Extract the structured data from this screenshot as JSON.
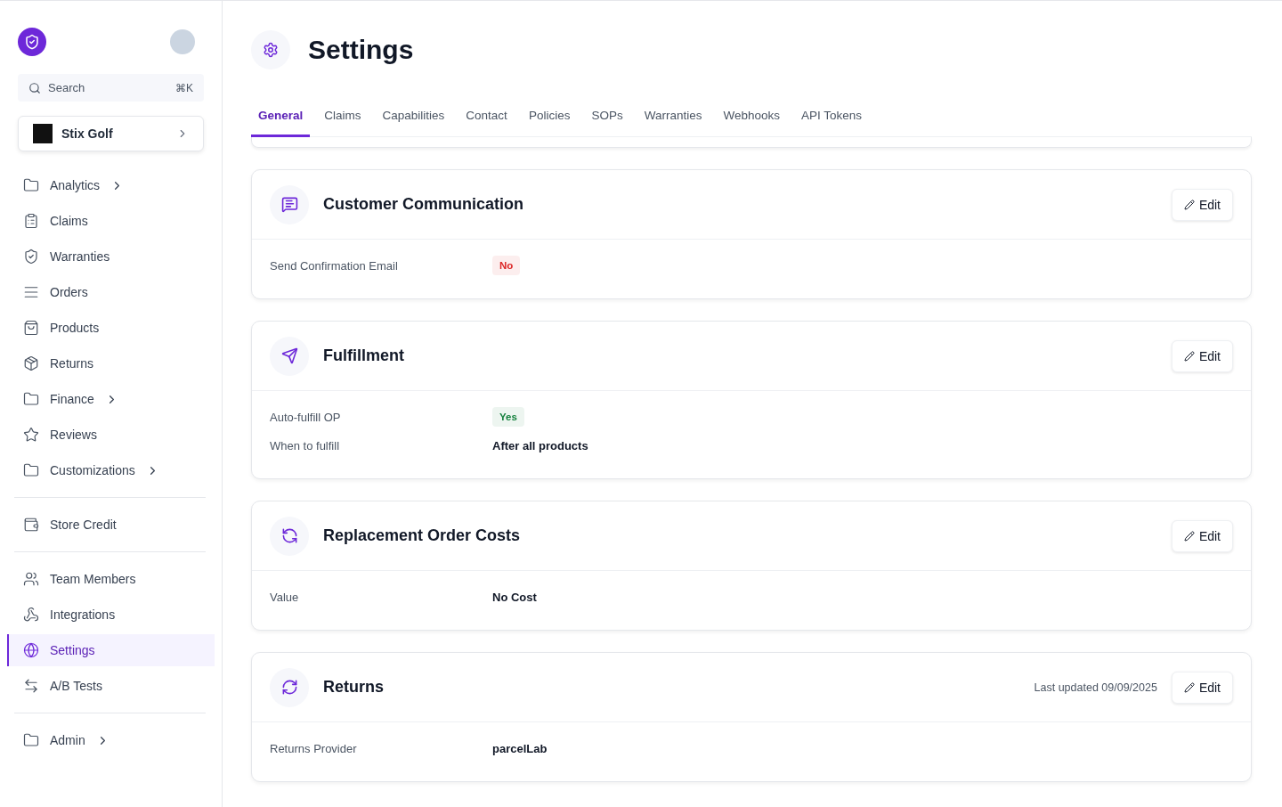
{
  "sidebar": {
    "search": {
      "placeholder": "Search",
      "shortcut": "⌘K"
    },
    "store": {
      "name": "Stix Golf"
    },
    "groups": [
      {
        "items": [
          {
            "label": "Analytics",
            "expandable": true,
            "selected": false
          },
          {
            "label": "Claims",
            "expandable": false,
            "selected": false
          },
          {
            "label": "Warranties",
            "expandable": false,
            "selected": false
          },
          {
            "label": "Orders",
            "expandable": false,
            "selected": false
          },
          {
            "label": "Products",
            "expandable": false,
            "selected": false
          },
          {
            "label": "Returns",
            "expandable": false,
            "selected": false
          },
          {
            "label": "Finance",
            "expandable": true,
            "selected": false
          },
          {
            "label": "Reviews",
            "expandable": false,
            "selected": false
          },
          {
            "label": "Customizations",
            "expandable": true,
            "selected": false
          }
        ]
      },
      {
        "items": [
          {
            "label": "Store Credit",
            "expandable": false,
            "selected": false
          }
        ]
      },
      {
        "items": [
          {
            "label": "Team Members",
            "expandable": false,
            "selected": false
          },
          {
            "label": "Integrations",
            "expandable": false,
            "selected": false
          },
          {
            "label": "Settings",
            "expandable": false,
            "selected": true
          },
          {
            "label": "A/B Tests",
            "expandable": false,
            "selected": false
          }
        ]
      },
      {
        "items": [
          {
            "label": "Admin",
            "expandable": true,
            "selected": false
          }
        ]
      }
    ]
  },
  "page": {
    "title": "Settings"
  },
  "tabs": [
    {
      "label": "General",
      "selected": true
    },
    {
      "label": "Claims",
      "selected": false
    },
    {
      "label": "Capabilities",
      "selected": false
    },
    {
      "label": "Contact",
      "selected": false
    },
    {
      "label": "Policies",
      "selected": false
    },
    {
      "label": "SOPs",
      "selected": false
    },
    {
      "label": "Warranties",
      "selected": false
    },
    {
      "label": "Webhooks",
      "selected": false
    },
    {
      "label": "API Tokens",
      "selected": false
    }
  ],
  "cards": [
    {
      "kind": "chat",
      "title": "Customer Communication",
      "edit": "Edit",
      "fields": [
        {
          "label": "Send Confirmation Email",
          "kind": "badge",
          "value": "No",
          "color": "#dc2626"
        }
      ]
    },
    {
      "kind": "send",
      "title": "Fulfillment",
      "edit": "Edit",
      "fields": [
        {
          "label": "Auto-fulfill OP",
          "kind": "badge",
          "value": "Yes",
          "color": "#15803d"
        },
        {
          "label": "When to fulfill",
          "kind": "text",
          "value": "After all products"
        }
      ]
    },
    {
      "kind": "cycle",
      "title": "Replacement Order Costs",
      "edit": "Edit",
      "fields": [
        {
          "label": "Value",
          "kind": "text",
          "value": "No Cost"
        }
      ]
    },
    {
      "kind": "refresh",
      "title": "Returns",
      "updated": "Last updated 09/09/2025",
      "edit": "Edit",
      "fields": [
        {
          "label": "Returns Provider",
          "kind": "text",
          "value": "parcelLab"
        }
      ]
    }
  ]
}
